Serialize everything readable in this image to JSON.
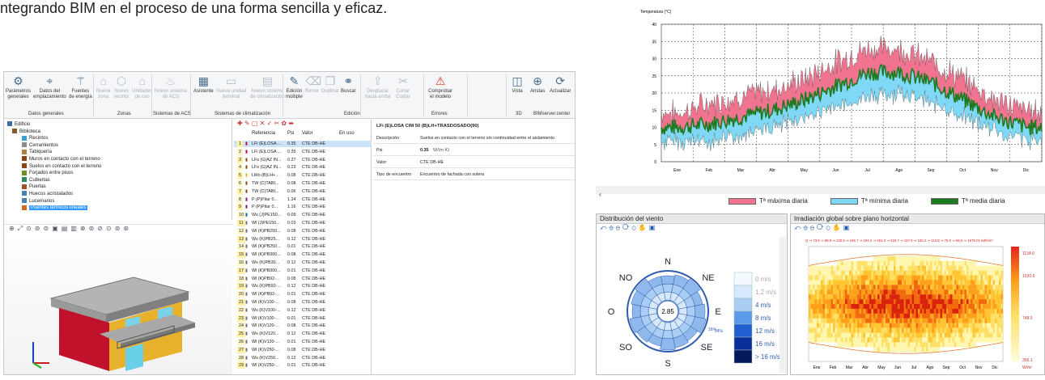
{
  "heading": "ntegrando BIM en el proceso de una forma sencilla y eficaz.",
  "ribbon": {
    "buttons": [
      {
        "l1": "Parámetros",
        "l2": "generales",
        "icon": "gear-icon",
        "x": 2,
        "dim": false
      },
      {
        "l1": "Datos del",
        "l2": "emplazamiento",
        "icon": "location-pin-icon",
        "x": 36,
        "dim": false
      },
      {
        "l1": "Fuentes",
        "l2": "de energía",
        "icon": "wind-turbine-icon",
        "x": 80,
        "dim": false
      },
      {
        "l1": "Nueva",
        "l2": "zona",
        "icon": "house-icon",
        "x": 114,
        "dim": true
      },
      {
        "l1": "Nuevo",
        "l2": "recinto",
        "icon": "room-icon",
        "x": 136,
        "dim": true
      },
      {
        "l1": "Unidades",
        "l2": "de uso",
        "icon": "units-icon",
        "x": 158,
        "dim": true
      },
      {
        "l1": "Nuevo sistema",
        "l2": "de ACS",
        "icon": "dhw-system-icon",
        "x": 186,
        "dim": true
      },
      {
        "l1": "Asistente",
        "l2": "",
        "icon": "wizard-icon",
        "x": 234,
        "dim": false
      },
      {
        "l1": "Nueva unidad",
        "l2": "terminal",
        "icon": "terminal-unit-icon",
        "x": 262,
        "dim": true
      },
      {
        "l1": "Nuevo sistema",
        "l2": "de climatización",
        "icon": "hvac-system-icon",
        "x": 304,
        "dim": true
      },
      {
        "l1": "Edición",
        "l2": "múltiple",
        "icon": "multi-edit-icon",
        "x": 348,
        "dim": false
      },
      {
        "l1": "Borrar",
        "l2": "",
        "icon": "erase-icon",
        "x": 372,
        "dim": true
      },
      {
        "l1": "Duplicar",
        "l2": "",
        "icon": "duplicate-icon",
        "x": 392,
        "dim": true
      },
      {
        "l1": "Buscar",
        "l2": "",
        "icon": "binoculars-icon",
        "x": 416,
        "dim": false
      },
      {
        "l1": "Desplazar",
        "l2": "hacia arriba",
        "icon": "move-up-icon",
        "x": 446,
        "dim": true
      },
      {
        "l1": "Cortar",
        "l2": "Copiar",
        "icon": "scissors-icon",
        "x": 484,
        "dim": true
      },
      {
        "l1": "Comprobar",
        "l2": "el modelo",
        "icon": "check-model-icon",
        "x": 524,
        "dim": false
      },
      {
        "l1": "Vista",
        "l2": "",
        "icon": "view-icon",
        "x": 626,
        "dim": false
      },
      {
        "l1": "Aristas",
        "l2": "",
        "icon": "edges-icon",
        "x": 650,
        "dim": false
      },
      {
        "l1": "Actualizar",
        "l2": "",
        "icon": "refresh-icon",
        "x": 674,
        "dim": false
      }
    ],
    "groups": [
      {
        "label": "Datos generales",
        "x": 30
      },
      {
        "label": "Zonas",
        "x": 140
      },
      {
        "label": "Sistemas de ACS",
        "x": 184
      },
      {
        "label": "Sistemas de climatización",
        "x": 260
      },
      {
        "label": "Edición",
        "x": 420
      },
      {
        "label": "Errores",
        "x": 528
      },
      {
        "label": "3D",
        "x": 632
      },
      {
        "label": "BIMserver.center",
        "x": 654
      }
    ]
  },
  "tree": [
    {
      "label": "Edificio",
      "indent": 4,
      "color": "#3a6ea5"
    },
    {
      "label": "Biblioteca",
      "indent": 10,
      "color": "#8b5a2b"
    },
    {
      "label": "Recintos",
      "indent": 22,
      "color": "#3aa3d0"
    },
    {
      "label": "Cerramientos",
      "indent": 22,
      "color": "#8b8b8b"
    },
    {
      "label": "Tabiquería",
      "indent": 22,
      "color": "#b08040"
    },
    {
      "label": "Muros en contacto con el terreno",
      "indent": 22,
      "color": "#8b4513"
    },
    {
      "label": "Suelos en contacto con el terreno",
      "indent": 22,
      "color": "#8b4513"
    },
    {
      "label": "Forjados entre pisos",
      "indent": 22,
      "color": "#6b8e23"
    },
    {
      "label": "Cubiertas",
      "indent": 22,
      "color": "#2e8b57"
    },
    {
      "label": "Puertas",
      "indent": 22,
      "color": "#a0522d"
    },
    {
      "label": "Huecos acristalados",
      "indent": 22,
      "color": "#4682b4"
    },
    {
      "label": "Lucernarios",
      "indent": 22,
      "color": "#4682b4"
    },
    {
      "label": "Puentes térmicos lineales",
      "indent": 22,
      "color": "#d2691e",
      "selected": true
    }
  ],
  "list": {
    "headers": [
      "Referencia",
      "Psi",
      "Valor",
      "En uso"
    ],
    "rows": [
      [
        "1",
        "LFi (E)LOSA ...",
        "0.35",
        "CTE DB-HE"
      ],
      [
        "2",
        "LFi (E)LOSA ...",
        "0.35",
        "CTE DB-HE"
      ],
      [
        "3",
        "LFs (G)AZ IN...",
        "0.27",
        "CTE DB-HE"
      ],
      [
        "4",
        "LFs (G)AZ IN...",
        "0.23",
        "CTE DB-HE"
      ],
      [
        "5",
        "LWo (B)LH+...",
        "0.08",
        "CTE DB-HE"
      ],
      [
        "6",
        "TW (C)TABI...",
        "0.08",
        "CTE DB-HE"
      ],
      [
        "7",
        "TW (C)TABI...",
        "0.06",
        "CTE DB-HE"
      ],
      [
        "8",
        "P (P)Pilar 0...",
        "1.24",
        "CTE DB-HE"
      ],
      [
        "9",
        "P (P)Pilar 0...",
        "1.16",
        "CTE DB-HE"
      ],
      [
        "10",
        "Ws (J)PE150...",
        "0.09",
        "CTE DB-HE"
      ],
      [
        "11",
        "Wl (J)PE150...",
        "0.03",
        "CTE DB-HE"
      ],
      [
        "12",
        "Wl (K)PB250...",
        "0.08",
        "CTE DB-HE"
      ],
      [
        "13",
        "Ws (K)PB25...",
        "0.12",
        "CTE DB-HE"
      ],
      [
        "14",
        "Wl (K)PB250...",
        "0.01",
        "CTE DB-HE"
      ],
      [
        "15",
        "Wl (K)PB300...",
        "0.08",
        "CTE DB-HE"
      ],
      [
        "16",
        "Ws (K)PB30...",
        "0.12",
        "CTE DB-HE"
      ],
      [
        "17",
        "Wl (K)PB300...",
        "0.01",
        "CTE DB-HE"
      ],
      [
        "18",
        "Wl (K)PB92-...",
        "0.08",
        "CTE DB-HE"
      ],
      [
        "19",
        "Ws (K)PB92-...",
        "0.12",
        "CTE DB-HE"
      ],
      [
        "20",
        "Wl (K)PB92-...",
        "0.01",
        "CTE DB-HE"
      ],
      [
        "21",
        "Wl (K)V100-...",
        "0.08",
        "CTE DB-HE"
      ],
      [
        "22",
        "Ws (K)V100-...",
        "0.12",
        "CTE DB-HE"
      ],
      [
        "23",
        "Wl (K)V100-...",
        "0.01",
        "CTE DB-HE"
      ],
      [
        "24",
        "Wl (K)V120-...",
        "0.08",
        "CTE DB-HE"
      ],
      [
        "25",
        "Ws (K)V120...",
        "0.12",
        "CTE DB-HE"
      ],
      [
        "26",
        "Wl (K)V120-...",
        "0.01",
        "CTE DB-HE"
      ],
      [
        "27",
        "Wl (K)V250-...",
        "0.08",
        "CTE DB-HE"
      ],
      [
        "28",
        "Ws (K)V250...",
        "0.12",
        "CTE DB-HE"
      ],
      [
        "29",
        "Wl (K)V250-...",
        "0.01",
        "CTE DB-HE"
      ]
    ]
  },
  "detail": {
    "title": "LFi (E)LOSA CIM 50 (B)LH+TRASDOSADO(90)",
    "rows": [
      {
        "k": "Descripción",
        "v": "Suelos en contacto con el terreno sin continuidad entre el aislamiento"
      },
      {
        "k": "Psi",
        "v": "0.35",
        "u": "W/(m·K)"
      },
      {
        "k": "Valor",
        "v": "CTE DB-HE"
      },
      {
        "k": "Tipo de encuentro",
        "v": "Encuentro de fachada con solera"
      }
    ]
  },
  "temp_chart": {
    "ylabel": "Temperatura (°C)",
    "ticks": [
      "40",
      "35",
      "30",
      "25",
      "20",
      "15",
      "10",
      "5",
      "0"
    ],
    "months": [
      "Ene",
      "Feb",
      "Mar",
      "Abr",
      "May",
      "Jun",
      "Jul",
      "Ago",
      "Sep",
      "Oct",
      "Nov",
      "Dic"
    ],
    "legend": [
      {
        "label": "Tª máxima diaria",
        "color": "#f0748f"
      },
      {
        "label": "Tª mínima diaria",
        "color": "#7fd8f5"
      },
      {
        "label": "Tª media diaria",
        "color": "#1e7a1e"
      }
    ]
  },
  "chart_data": {
    "type": "area",
    "x": [
      "Ene",
      "Feb",
      "Mar",
      "Abr",
      "May",
      "Jun",
      "Jul",
      "Ago",
      "Sep",
      "Oct",
      "Nov",
      "Dic"
    ],
    "ylabel": "Temperatura (°C)",
    "ylim": [
      0,
      40
    ],
    "series": [
      {
        "name": "Tª máxima diaria",
        "values": [
          14,
          17,
          19,
          21,
          24,
          29,
          33,
          33,
          29,
          24,
          18,
          15
        ]
      },
      {
        "name": "Tª media diaria",
        "values": [
          10,
          11,
          13,
          15,
          18,
          22,
          26,
          26,
          23,
          18,
          13,
          10
        ]
      },
      {
        "name": "Tª mínima diaria",
        "values": [
          6,
          6,
          8,
          10,
          13,
          16,
          19,
          20,
          17,
          13,
          9,
          6
        ]
      }
    ]
  },
  "wind": {
    "title": "Distribución del viento",
    "center": "2.85",
    "dirs": [
      "N",
      "NE",
      "E",
      "SE",
      "S",
      "SO",
      "O",
      "NO"
    ],
    "pct": [
      "16%",
      "24%"
    ],
    "legend": [
      {
        "label": "0 m/s",
        "color": "#f4f9ff"
      },
      {
        "label": "1.2 m/s",
        "color": "#d6e8fb"
      },
      {
        "label": "4 m/s",
        "color": "#a9cdf3"
      },
      {
        "label": "8 m/s",
        "color": "#5a9ae6"
      },
      {
        "label": "12 m/s",
        "color": "#1f5fd0"
      },
      {
        "label": "16 m/s",
        "color": "#0a2f99"
      },
      {
        "label": "> 16 m/s",
        "color": "#041a5c"
      }
    ]
  },
  "irr": {
    "title": "Irradiación global sobre plano horizontal",
    "qline": "Q ⇒ 73.8 ⇒ 88.9 ⇒ 130.5 ⇒ 156.7 ⇒ 194.2 ⇒ 204.3 ⇒ 219.7 ⇒ 197.9 ⇒ 150.2 ⇒ 113.8 ⇒ 79.0 ⇒ 66.0 ⇒ 1675.01 kWh/m²",
    "months": [
      "Ene",
      "Feb",
      "Mar",
      "Abr",
      "May",
      "Jun",
      "Jul",
      "Ago",
      "Sep",
      "Oct",
      "Nov",
      "Dic"
    ],
    "scale": [
      "1134.0",
      "1020.6",
      "748.5",
      "356.1"
    ],
    "unit": "W/m²"
  }
}
